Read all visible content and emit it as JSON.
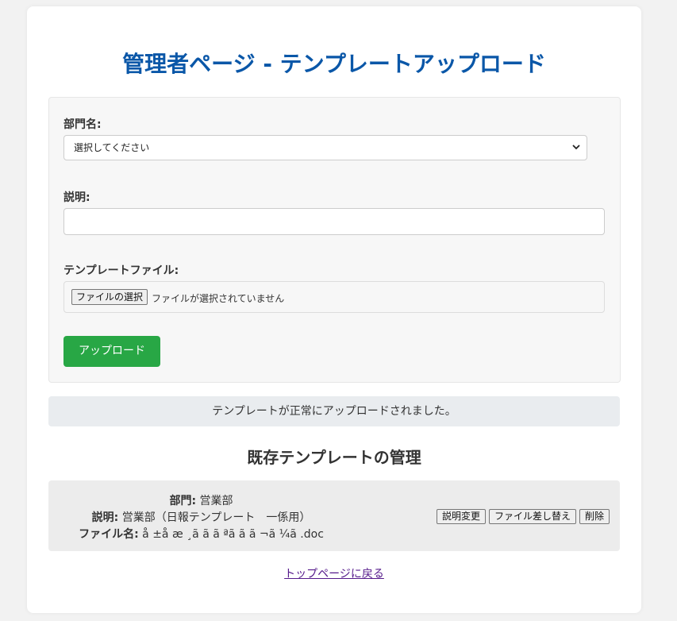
{
  "page": {
    "title": "管理者ページ - テンプレートアップロード"
  },
  "form": {
    "department_label": "部門名:",
    "department_select": "選択してください",
    "description_label": "説明:",
    "description_value": "",
    "file_label": "テンプレートファイル:",
    "file_button": "ファイルの選択",
    "file_status": "ファイルが選択されていません",
    "upload_button": "アップロード"
  },
  "alert": {
    "message": "テンプレートが正常にアップロードされました。"
  },
  "existing": {
    "title": "既存テンプレートの管理",
    "items": [
      {
        "department_label": "部門:",
        "department": "営業部",
        "description_label": "説明:",
        "description": "営業部（日報テンプレート　一係用）",
        "filename_label": "ファイル名:",
        "filename": "å ±å æ ¸ã ã ã ªã ã ã ¬ã ¼ã .doc",
        "buttons": {
          "edit": "説明変更",
          "replace": "ファイル差し替え",
          "delete": "削除"
        }
      }
    ]
  },
  "footer": {
    "back_link": "トップページに戻る"
  }
}
